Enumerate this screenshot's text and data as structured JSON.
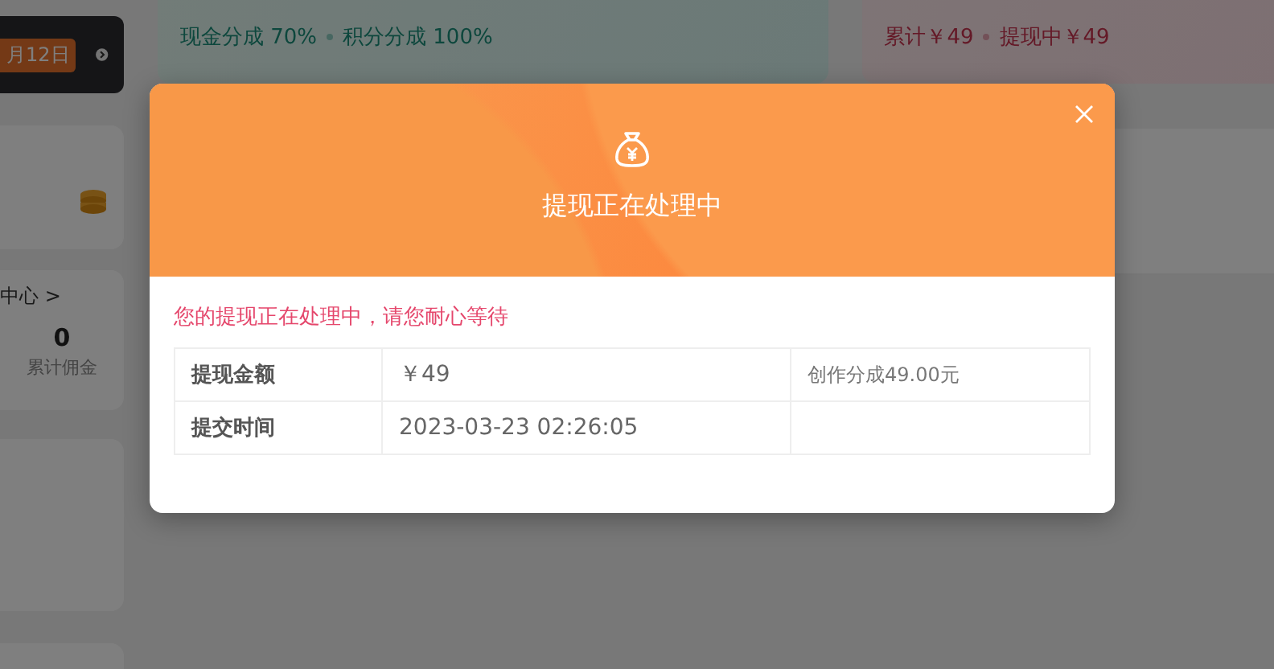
{
  "page": {
    "date_badge": "月12日",
    "share_stats": [
      "现金分成 70%",
      "积分分成 100%"
    ],
    "balance_stats": [
      "累计￥49",
      "提现中￥49"
    ],
    "center_link": "中心 >",
    "commission": {
      "value": "0",
      "label": "累计佣金"
    }
  },
  "dialog": {
    "title": "提现正在处理中",
    "message": "您的提现正在处理中，请您耐心等待",
    "rows": [
      {
        "label": "提现金额",
        "value": "￥49",
        "note": "创作分成49.00元"
      },
      {
        "label": "提交时间",
        "value": "2023-03-23 02:26:05"
      }
    ]
  }
}
